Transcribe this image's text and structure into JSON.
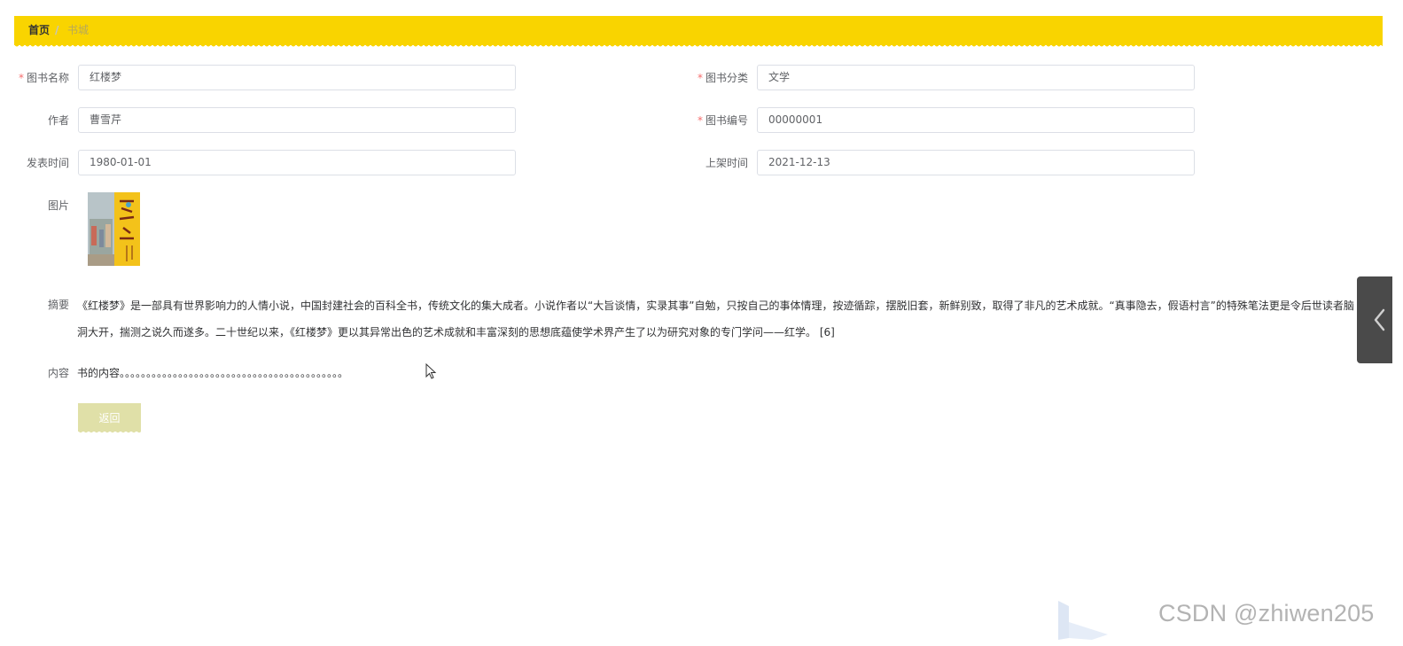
{
  "breadcrumb": {
    "home": "首页",
    "separator": "/",
    "current": "书城"
  },
  "form": {
    "book_name": {
      "label": "图书名称",
      "value": "红楼梦",
      "required": true
    },
    "category": {
      "label": "图书分类",
      "value": "文学",
      "required": true
    },
    "author": {
      "label": "作者",
      "value": "曹雪芹",
      "required": false
    },
    "book_number": {
      "label": "图书编号",
      "value": "00000001",
      "required": true
    },
    "publish_date": {
      "label": "发表时间",
      "value": "1980-01-01",
      "required": false
    },
    "shelf_date": {
      "label": "上架时间",
      "value": "2021-12-13",
      "required": false
    },
    "image": {
      "label": "图片"
    },
    "summary": {
      "label": "摘要",
      "value": "《红楼梦》是一部具有世界影响力的人情小说，中国封建社会的百科全书，传统文化的集大成者。小说作者以“大旨谈情，实录其事”自勉，只按自己的事体情理，按迹循踪，摆脱旧套，新鲜别致，取得了非凡的艺术成就。“真事隐去，假语村言”的特殊笔法更是令后世读者脑洞大开，揣测之说久而遂多。二十世纪以来，《红楼梦》更以其异常出色的艺术成就和丰富深刻的思想底蕴使学术界产生了以为研究对象的专门学问——红学。 [6]"
    },
    "content": {
      "label": "内容",
      "value": "书的内容。。。。。。。。。。。。。。。。。。。。。。。。。。。。。。。。。。。。。。。。。。"
    },
    "back_button": "返回"
  },
  "required_marker": "*",
  "watermark": "CSDN @zhiwen205",
  "colors": {
    "accent": "#f9d400",
    "required": "#f56c6c",
    "back_button_bg": "#e0e0a8",
    "side_tab": "#4a4a4a"
  },
  "icons": {
    "side_tab": "chevron-left-icon",
    "cursor": "mouse-cursor-icon"
  }
}
